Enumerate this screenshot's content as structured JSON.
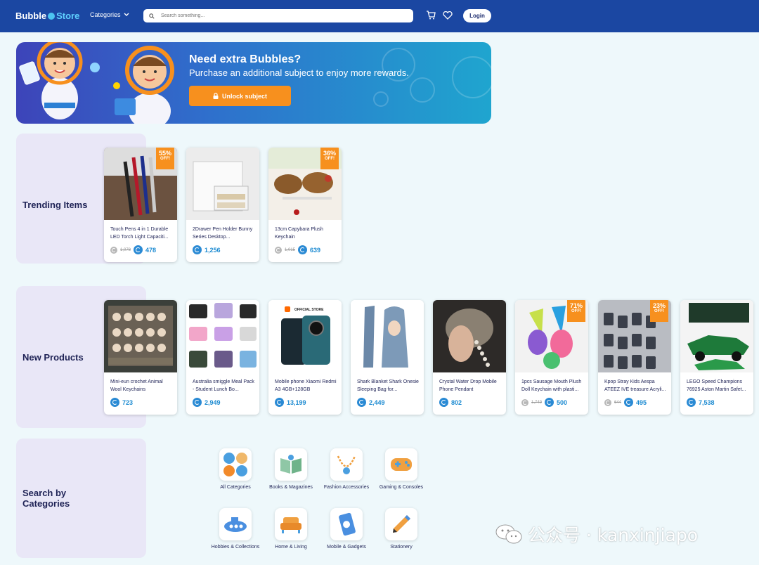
{
  "header": {
    "logo_left": "Bubble",
    "logo_right": "Store",
    "categories_label": "Categories",
    "search_placeholder": "Search something...",
    "login_label": "Login"
  },
  "banner": {
    "title": "Need extra Bubbles?",
    "subtitle": "Purchase an additional subject to enjoy more rewards.",
    "button_label": "Unlock subject"
  },
  "trending": {
    "title": "Trending Items",
    "items": [
      {
        "name": "Touch Pens 4 in 1 Durable LED Torch Light Capaciti...",
        "old_price": "1,078",
        "price": "478",
        "discount": "55%",
        "off": "OFF!"
      },
      {
        "name": "2Drawer Pen Holder Bunny Series Desktop...",
        "old_price": "",
        "price": "1,256",
        "discount": "",
        "off": ""
      },
      {
        "name": "13cm Capybara Plush Keychain",
        "old_price": "1,015",
        "price": "639",
        "discount": "36%",
        "off": "OFF!"
      }
    ]
  },
  "new_products": {
    "title": "New Products",
    "official_store": "OFFICIAL STORE",
    "items": [
      {
        "name": "Mini-eun crochet Animal Wool Keychains",
        "old_price": "",
        "price": "723",
        "discount": "",
        "off": ""
      },
      {
        "name": "Australia smiggle Meal Pack - Student Lunch Bo...",
        "old_price": "",
        "price": "2,949",
        "discount": "",
        "off": ""
      },
      {
        "name": "Mobile phone Xiaomi Redmi A3 4GB+128GB",
        "old_price": "",
        "price": "13,199",
        "discount": "",
        "off": ""
      },
      {
        "name": "Shark Blanket Shark Onesie Sleeping Bag for...",
        "old_price": "",
        "price": "2,449",
        "discount": "",
        "off": ""
      },
      {
        "name": "Crystal Water Drop Mobile Phone Pendant",
        "old_price": "",
        "price": "802",
        "discount": "",
        "off": ""
      },
      {
        "name": "1pcs Sausage Mouth Plush Doll Keychain with plasti...",
        "old_price": "1,749",
        "price": "500",
        "discount": "71%",
        "off": "OFF!"
      },
      {
        "name": "Kpop Stray Kids Aespa ATEEZ IVE treasure Acryli...",
        "old_price": "644",
        "price": "495",
        "discount": "23%",
        "off": "OFF!"
      },
      {
        "name": "LEGO Speed Champions 76925 Aston Martin Safet...",
        "old_price": "",
        "price": "7,538",
        "discount": "",
        "off": ""
      }
    ]
  },
  "categories": {
    "title_line1": "Search by",
    "title_line2": "Categories",
    "items": [
      {
        "label": "All Categories",
        "icon": "grid-dots-icon"
      },
      {
        "label": "Books & Magazines",
        "icon": "book-icon"
      },
      {
        "label": "Fashion Accessories",
        "icon": "necklace-icon"
      },
      {
        "label": "Gaming & Consoles",
        "icon": "gamepad-icon"
      },
      {
        "label": "Hobbies & Collections",
        "icon": "submarine-icon"
      },
      {
        "label": "Home & Living",
        "icon": "sofa-icon"
      },
      {
        "label": "Mobile & Gadgets",
        "icon": "smartphone-icon"
      },
      {
        "label": "Stationery",
        "icon": "pencil-icon"
      }
    ]
  },
  "watermark": "公众号 · kanxinjiapo",
  "colors": {
    "header": "#1b47a2",
    "accent": "#f7901e",
    "price": "#1b8ad1",
    "panel": "#e9e7f7"
  }
}
